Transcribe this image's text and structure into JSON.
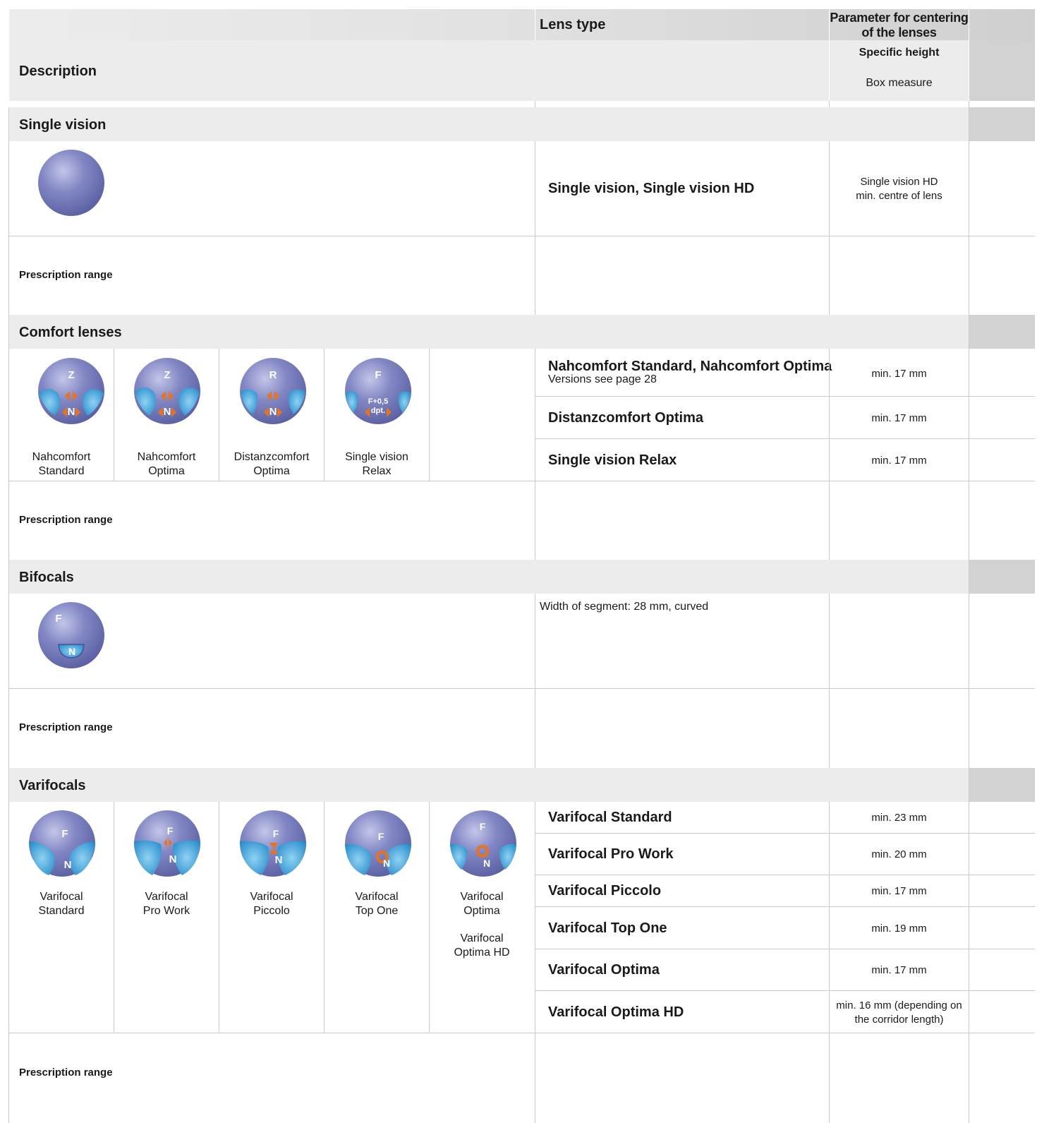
{
  "header": {
    "lens_type": "Lens type",
    "parameter": "Parameter for centering of the lenses",
    "description": "Description",
    "specific_height": "Specific height",
    "box_measure": "Box measure"
  },
  "sections": {
    "single_vision": {
      "title": "Single vision",
      "lens_type": "Single vision, Single vision HD",
      "parameter": [
        "Single vision HD",
        "min. centre of lens"
      ],
      "prescription": "Prescription range"
    },
    "comfort": {
      "title": "Comfort lenses",
      "captions": [
        [
          "Nahcomfort",
          "Standard"
        ],
        [
          "Nahcomfort",
          "Optima"
        ],
        [
          "Distanzcomfort",
          "Optima"
        ],
        [
          "Single vision",
          "Relax"
        ]
      ],
      "icon_labels": [
        [
          "Z",
          "N"
        ],
        [
          "Z",
          "N"
        ],
        [
          "R",
          "N"
        ],
        [
          "F",
          "F+0,5",
          "dpt."
        ]
      ],
      "rows": [
        {
          "type": "Nahcomfort Standard, Nahcomfort Optima",
          "note": "Versions see page 28",
          "param": "min. 17 mm"
        },
        {
          "type": "Distanzcomfort Optima",
          "param": "min. 17 mm"
        },
        {
          "type": "Single vision Relax",
          "param": "min. 17 mm"
        }
      ],
      "prescription": "Prescription range"
    },
    "bifocals": {
      "title": "Bifocals",
      "icon_labels": [
        "F",
        "N"
      ],
      "segment": "Width of segment: 28 mm, curved",
      "prescription": "Prescription range"
    },
    "varifocals": {
      "title": "Varifocals",
      "captions": [
        [
          "Varifocal",
          "Standard"
        ],
        [
          "Varifocal",
          "Pro Work"
        ],
        [
          "Varifocal",
          "Piccolo"
        ],
        [
          "Varifocal",
          "Top One"
        ],
        [
          "Varifocal",
          "Optima",
          "Varifocal",
          "Optima HD"
        ]
      ],
      "rows": [
        {
          "type": "Varifocal Standard",
          "param": [
            "min. 23 mm"
          ]
        },
        {
          "type": "Varifocal Pro Work",
          "param": [
            "min. 20 mm"
          ]
        },
        {
          "type": "Varifocal Piccolo",
          "param": [
            "min. 17 mm"
          ]
        },
        {
          "type": "Varifocal Top One",
          "param": [
            "min. 19 mm"
          ]
        },
        {
          "type": "Varifocal Optima",
          "param": [
            "min. 17 mm"
          ]
        },
        {
          "type": "Varifocal Optima HD",
          "param": [
            "min. 16 mm (depending on",
            "the corridor length)"
          ]
        }
      ],
      "prescription": "Prescription range"
    }
  },
  "colors": {
    "lens_purple": "#6f74b4",
    "lens_blue": "#3aa4dc",
    "arrow_orange": "#e8731e",
    "header_gray": "#ececec"
  }
}
